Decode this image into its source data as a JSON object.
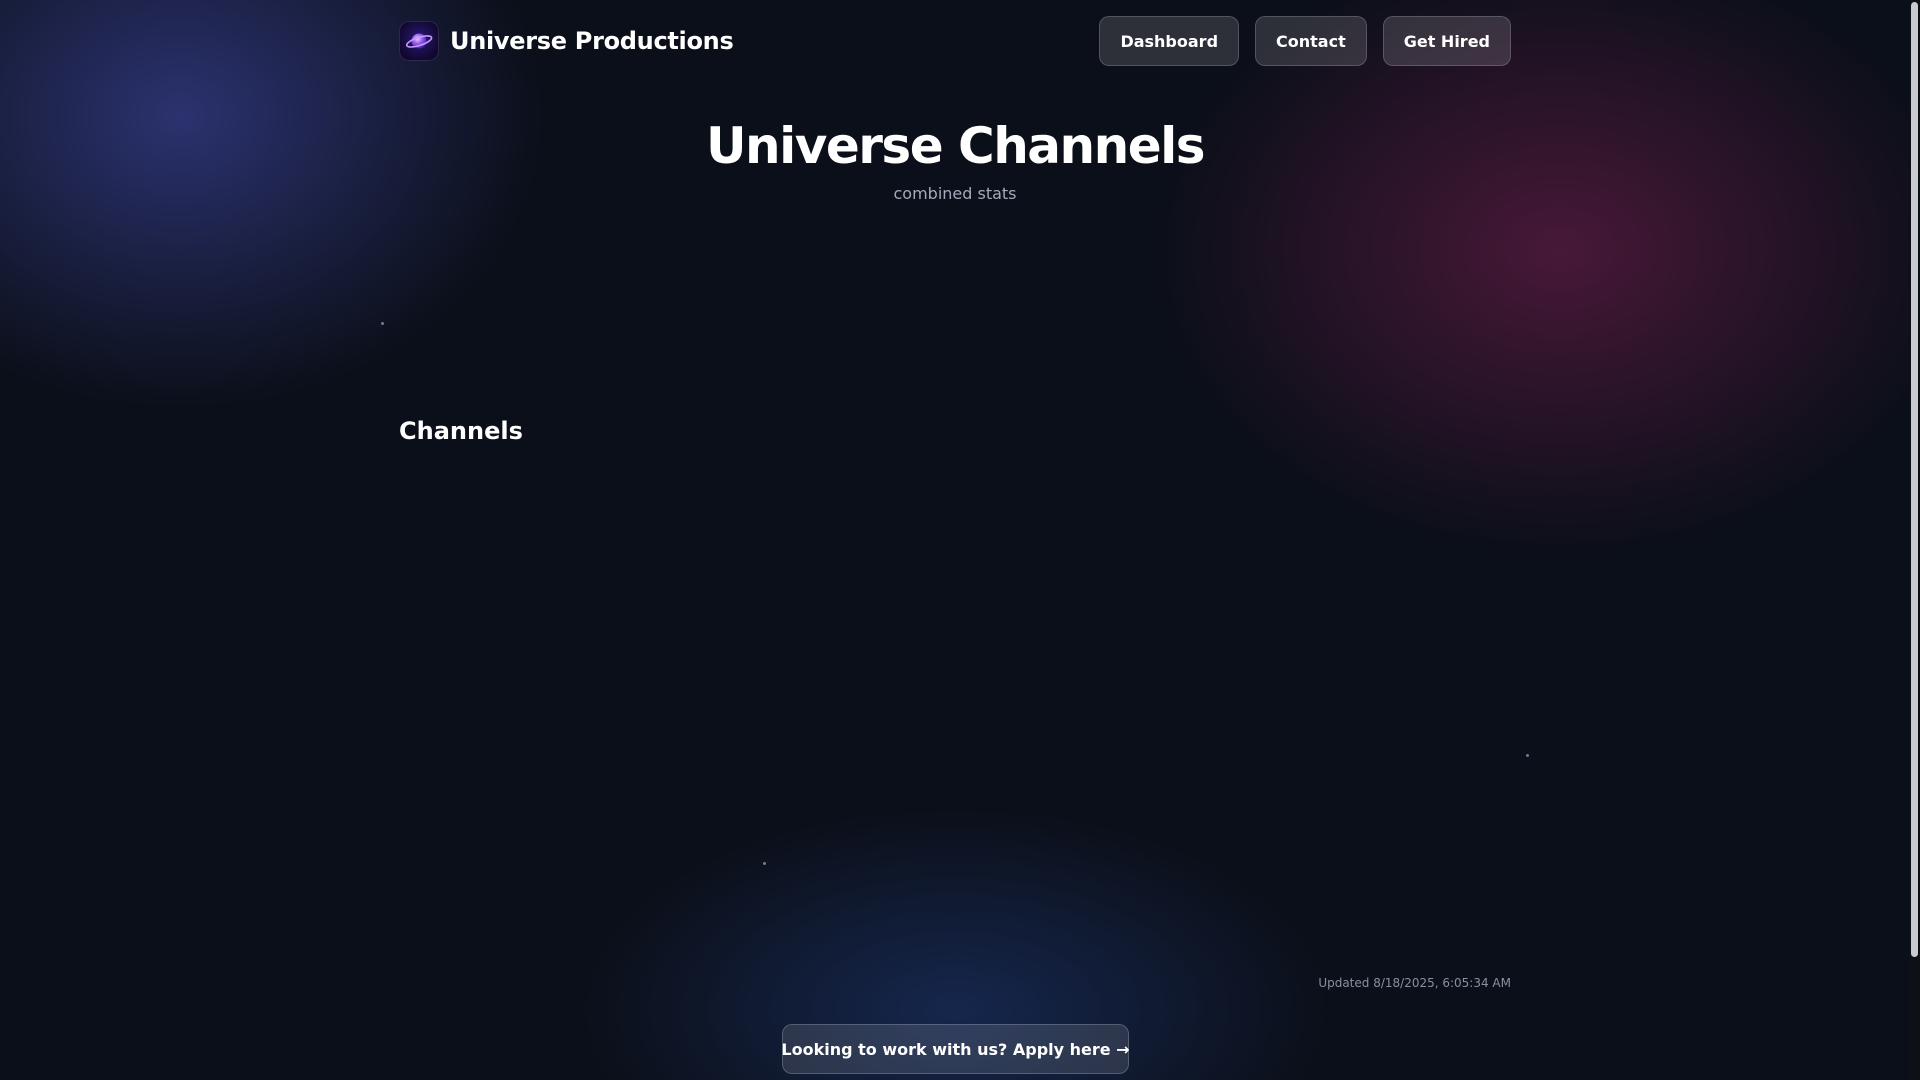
{
  "header": {
    "brand_name": "Universe Productions",
    "logo_icon": "planet-icon",
    "nav": [
      {
        "label": "Dashboard"
      },
      {
        "label": "Contact"
      },
      {
        "label": "Get Hired"
      }
    ]
  },
  "hero": {
    "title": "Universe Channels",
    "subtitle": "combined stats"
  },
  "channels": {
    "heading": "Channels",
    "items": []
  },
  "footer": {
    "updated": "Updated 8/18/2025, 6:05:34 AM",
    "apply_label": "Looking to work with us? Apply here →"
  },
  "theme": {
    "background": "#0b0f19",
    "glow_blue": "#363e8c",
    "glow_magenta": "#701e4c",
    "text_muted": "#a4a9bb"
  }
}
